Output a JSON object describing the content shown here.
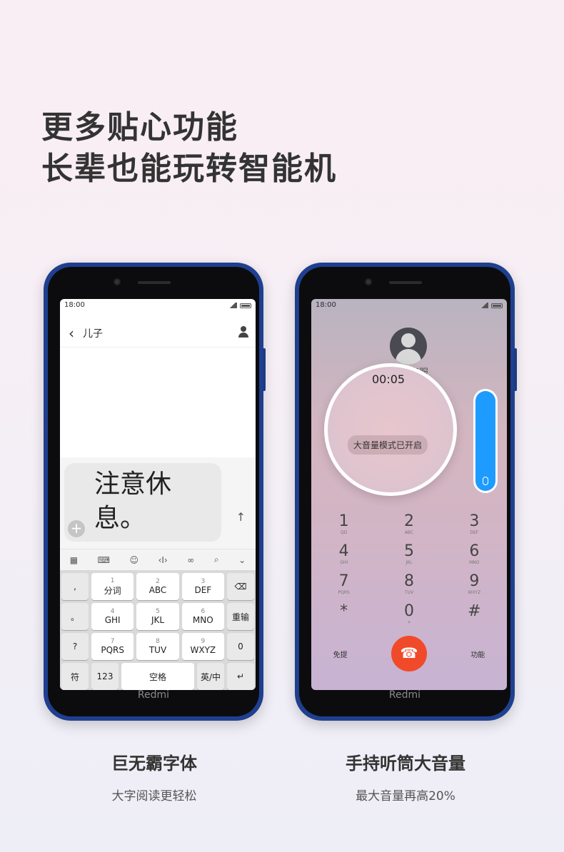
{
  "headline": {
    "line1": "更多贴心功能",
    "line2": "长辈也能玩转智能机"
  },
  "phones": {
    "brand": "Redmi",
    "time": "18:00"
  },
  "chat": {
    "contact": "儿子",
    "message": "注意休息。",
    "toolbar": [
      "grid-icon",
      "keyboard-icon",
      "emoji-icon",
      "cursor-icon",
      "link-icon",
      "search-icon",
      "chevron-down-icon"
    ],
    "keys": {
      "r1": [
        {
          "num": "1",
          "label": "分词"
        },
        {
          "num": "2",
          "label": "ABC"
        },
        {
          "num": "3",
          "label": "DEF"
        }
      ],
      "r2": [
        {
          "num": "4",
          "label": "GHI"
        },
        {
          "num": "5",
          "label": "JKL"
        },
        {
          "num": "6",
          "label": "MNO"
        }
      ],
      "r3": [
        {
          "num": "7",
          "label": "PQRS"
        },
        {
          "num": "8",
          "label": "TUV"
        },
        {
          "num": "9",
          "label": "WXYZ"
        }
      ],
      "punct": [
        ",",
        "。",
        "?",
        "!"
      ],
      "reinput": "重输",
      "zero": "0",
      "sym": "符",
      "num123": "123",
      "space": "空格",
      "lang": "英/中"
    }
  },
  "call": {
    "name": "客服",
    "timer": "00:05",
    "toast": "大音量模式已开启",
    "volume_level": 1.0,
    "dial": [
      [
        {
          "d": "1",
          "s": "QD"
        },
        {
          "d": "2",
          "s": "ABC"
        },
        {
          "d": "3",
          "s": "DEF"
        }
      ],
      [
        {
          "d": "4",
          "s": "GHI"
        },
        {
          "d": "5",
          "s": "JKL"
        },
        {
          "d": "6",
          "s": "MNO"
        }
      ],
      [
        {
          "d": "7",
          "s": "PQRS"
        },
        {
          "d": "8",
          "s": "TUV"
        },
        {
          "d": "9",
          "s": "WXYZ"
        }
      ],
      [
        {
          "d": "*",
          "s": ""
        },
        {
          "d": "0",
          "s": "+"
        },
        {
          "d": "#",
          "s": ""
        }
      ]
    ],
    "handsfree": "免提",
    "function": "功能"
  },
  "captions": {
    "left": {
      "title": "巨无霸字体",
      "sub": "大字阅读更轻松"
    },
    "right": {
      "title": "手持听筒大音量",
      "sub": "最大音量再高20%"
    }
  },
  "colors": {
    "phone_body": "#1f3f8f",
    "volume": "#1e9bff",
    "hangup": "#f14a2a"
  }
}
